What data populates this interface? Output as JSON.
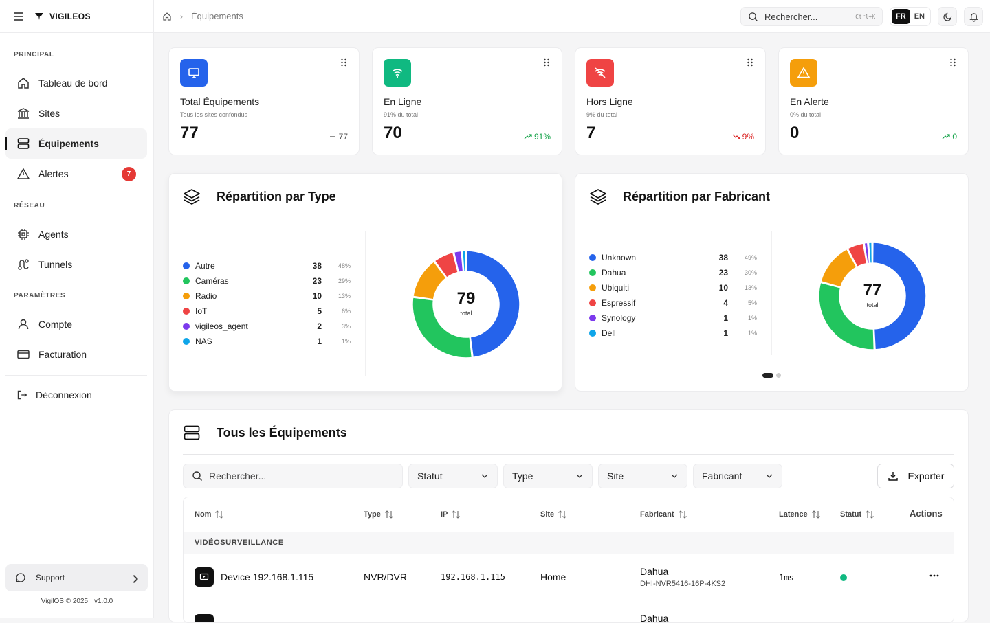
{
  "app": {
    "name": "VIGILEOS",
    "copyright": "VigilOS © 2025 · v1.0.0"
  },
  "breadcrumb": {
    "current": "Équipements"
  },
  "topbar": {
    "search_placeholder": "Rechercher...",
    "shortcut": "Ctrl+K",
    "lang_active": "FR",
    "lang_other": "EN"
  },
  "sidebar": {
    "sections": {
      "principal": "PRINCIPAL",
      "reseau": "RÉSEAU",
      "parametres": "PARAMÈTRES"
    },
    "items": [
      {
        "label": "Tableau de bord",
        "icon": "home-icon"
      },
      {
        "label": "Sites",
        "icon": "bank-icon"
      },
      {
        "label": "Équipements",
        "icon": "server-icon",
        "active": true
      },
      {
        "label": "Alertes",
        "icon": "alert-icon",
        "badge": "7"
      },
      {
        "label": "Agents",
        "icon": "cpu-icon"
      },
      {
        "label": "Tunnels",
        "icon": "route-icon"
      },
      {
        "label": "Compte",
        "icon": "user-icon"
      },
      {
        "label": "Facturation",
        "icon": "credit-card-icon"
      }
    ],
    "logout": "Déconnexion",
    "support": "Support"
  },
  "stats": [
    {
      "label": "Total Équipements",
      "sub": "Tous les sites confondus",
      "value": "77",
      "trend": "77",
      "trend_dir": "flat",
      "color": "#2563eb",
      "trend_color": "#555555"
    },
    {
      "label": "En Ligne",
      "sub": "91% du total",
      "value": "70",
      "trend": "91%",
      "trend_dir": "up",
      "color": "#10b981",
      "trend_color": "#16a34a"
    },
    {
      "label": "Hors Ligne",
      "sub": "9% du total",
      "value": "7",
      "trend": "9%",
      "trend_dir": "down",
      "color": "#ef4444",
      "trend_color": "#dc2626"
    },
    {
      "label": "En Alerte",
      "sub": "0% du total",
      "value": "0",
      "trend": "0",
      "trend_dir": "up",
      "color": "#f59e0b",
      "trend_color": "#16a34a"
    }
  ],
  "chart_data": [
    {
      "type": "pie",
      "title": "Répartition par Type",
      "center_value": "79",
      "center_label": "total",
      "categories": [
        "Autre",
        "Caméras",
        "Radio",
        "IoT",
        "vigileos_agent",
        "NAS"
      ],
      "values": [
        38,
        23,
        10,
        5,
        2,
        1
      ],
      "percents": [
        "48%",
        "29%",
        "13%",
        "6%",
        "3%",
        "1%"
      ],
      "colors": [
        "#2563eb",
        "#22c55e",
        "#f59e0b",
        "#ef4444",
        "#7c3aed",
        "#0ea5e9"
      ]
    },
    {
      "type": "pie",
      "title": "Répartition par Fabricant",
      "center_value": "77",
      "center_label": "total",
      "categories": [
        "Unknown",
        "Dahua",
        "Ubiquiti",
        "Espressif",
        "Synology",
        "Dell"
      ],
      "values": [
        38,
        23,
        10,
        4,
        1,
        1
      ],
      "percents": [
        "49%",
        "30%",
        "13%",
        "5%",
        "1%",
        "1%"
      ],
      "colors": [
        "#2563eb",
        "#22c55e",
        "#f59e0b",
        "#ef4444",
        "#7c3aed",
        "#0ea5e9"
      ]
    }
  ],
  "devices_panel": {
    "title": "Tous les Équipements",
    "search_placeholder": "Rechercher...",
    "filters": [
      "Statut",
      "Type",
      "Site",
      "Fabricant"
    ],
    "export": "Exporter",
    "columns": [
      "Nom",
      "Type",
      "IP",
      "Site",
      "Fabricant",
      "Latence",
      "Statut",
      "Actions"
    ],
    "group": "VIDÉOSURVEILLANCE",
    "rows": [
      {
        "name": "Device 192.168.1.115",
        "type": "NVR/DVR",
        "ip": "192.168.1.115",
        "site": "Home",
        "vendor": "Dahua",
        "model": "DHI-NVR5416-16P-4KS2",
        "latency": "1ms",
        "status_color": "#10b981"
      },
      {
        "name": "",
        "type": "",
        "ip": "",
        "site": "",
        "vendor": "Dahua",
        "model": "",
        "latency": "",
        "status_color": "#10b981"
      }
    ]
  }
}
